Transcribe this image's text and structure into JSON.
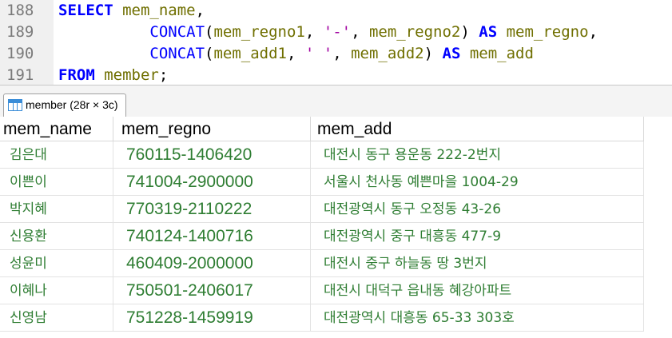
{
  "editor": {
    "lines": [
      {
        "num": "188",
        "tokens": [
          {
            "t": "SELECT",
            "c": "kw"
          },
          {
            "t": " ",
            "c": "pn"
          },
          {
            "t": "mem_name",
            "c": "id"
          },
          {
            "t": ",",
            "c": "pn"
          }
        ]
      },
      {
        "num": "189",
        "tokens": [
          {
            "t": "          ",
            "c": "pn"
          },
          {
            "t": "CONCAT",
            "c": "fn"
          },
          {
            "t": "(",
            "c": "pn"
          },
          {
            "t": "mem_regno1",
            "c": "id"
          },
          {
            "t": ", ",
            "c": "pn"
          },
          {
            "t": "'-'",
            "c": "str"
          },
          {
            "t": ", ",
            "c": "pn"
          },
          {
            "t": "mem_regno2",
            "c": "id"
          },
          {
            "t": ") ",
            "c": "pn"
          },
          {
            "t": "AS",
            "c": "kw"
          },
          {
            "t": " ",
            "c": "pn"
          },
          {
            "t": "mem_regno",
            "c": "id"
          },
          {
            "t": ",",
            "c": "pn"
          }
        ]
      },
      {
        "num": "190",
        "tokens": [
          {
            "t": "          ",
            "c": "pn"
          },
          {
            "t": "CONCAT",
            "c": "fn"
          },
          {
            "t": "(",
            "c": "pn"
          },
          {
            "t": "mem_add1",
            "c": "id"
          },
          {
            "t": ", ",
            "c": "pn"
          },
          {
            "t": "' '",
            "c": "str"
          },
          {
            "t": ", ",
            "c": "pn"
          },
          {
            "t": "mem_add2",
            "c": "id"
          },
          {
            "t": ") ",
            "c": "pn"
          },
          {
            "t": "AS",
            "c": "kw"
          },
          {
            "t": " ",
            "c": "pn"
          },
          {
            "t": "mem_add",
            "c": "id"
          }
        ]
      },
      {
        "num": "191",
        "tokens": [
          {
            "t": "FROM",
            "c": "kw"
          },
          {
            "t": " ",
            "c": "pn"
          },
          {
            "t": "member",
            "c": "id"
          },
          {
            "t": ";",
            "c": "pn"
          }
        ]
      }
    ]
  },
  "result_tab": {
    "icon": "table-grid-icon",
    "label": "member (28r × 3c)"
  },
  "grid": {
    "columns": [
      "mem_name",
      "mem_regno",
      "mem_add"
    ],
    "rows": [
      [
        "김은대",
        "760115-1406420",
        "대전시 동구 용운동 222-2번지"
      ],
      [
        "이쁜이",
        "741004-2900000",
        "서울시 천사동 예쁜마을 1004-29"
      ],
      [
        "박지혜",
        "770319-2110222",
        "대전광역시 동구 오정동 43-26"
      ],
      [
        "신용환",
        "740124-1400716",
        "대전광역시 중구 대흥동 477-9"
      ],
      [
        "성윤미",
        "460409-2000000",
        "대전시 중구 하늘동  땅 3번지"
      ],
      [
        "이혜나",
        "750501-2406017",
        "대전시 대덕구 읍내동 혜강아파트"
      ],
      [
        "신영남",
        "751228-1459919",
        "대전광역시 대흥동 65-33 303호"
      ]
    ],
    "value_color": "#2e7d32"
  }
}
